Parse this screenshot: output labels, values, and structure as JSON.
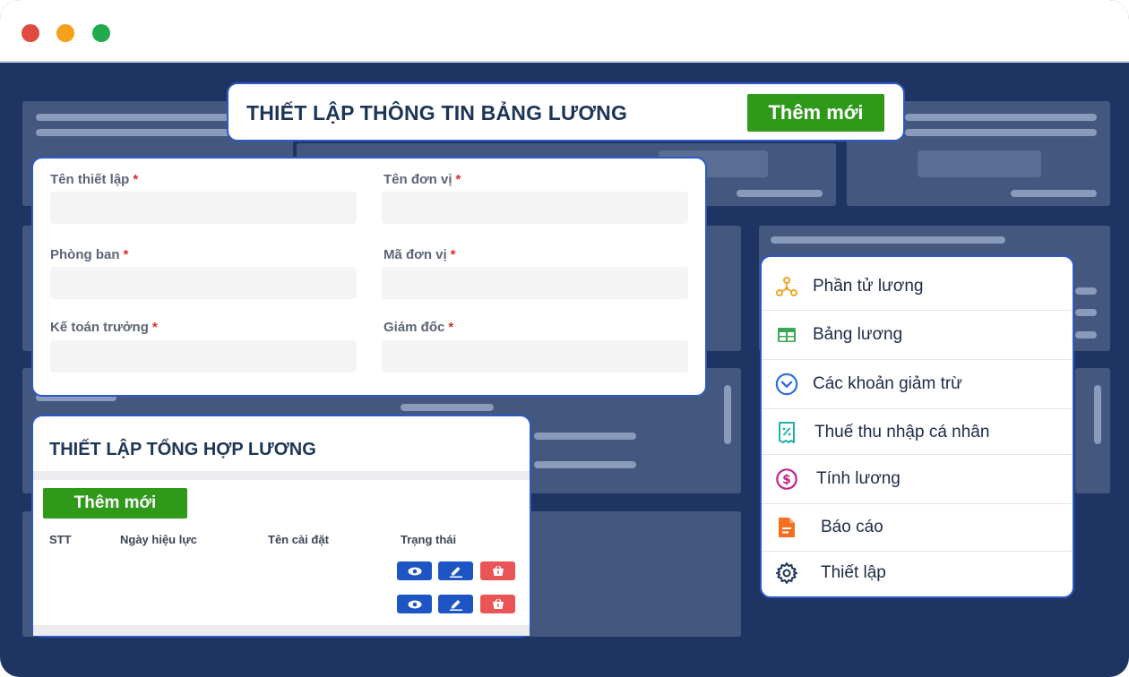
{
  "window": {
    "controls": [
      {
        "name": "close",
        "color": "#e04b40"
      },
      {
        "name": "minimize",
        "color": "#f5a11c"
      },
      {
        "name": "maximize",
        "color": "#23a94d"
      }
    ]
  },
  "header_card": {
    "title": "THIẾT LẬP THÔNG TIN BẢNG LƯƠNG",
    "add_button": "Thêm mới"
  },
  "form": {
    "fields": [
      {
        "label": "Tên thiết lập",
        "required": "*",
        "value": ""
      },
      {
        "label": "Tên đơn vị",
        "required": "*",
        "value": ""
      },
      {
        "label": "Phòng ban",
        "required": "*",
        "value": ""
      },
      {
        "label": "Mã đơn vị",
        "required": "*",
        "value": ""
      },
      {
        "label": "Kế toán trưởng",
        "required": "*",
        "value": ""
      },
      {
        "label": "Giám đốc",
        "required": "*",
        "value": ""
      }
    ]
  },
  "summary": {
    "title": "THIẾT LẬP TỔNG HỢP LƯƠNG",
    "add_button": "Thêm mới",
    "columns": [
      "STT",
      "Ngày hiệu lực",
      "Tên cài đặt",
      "Trạng thái"
    ],
    "row_actions": [
      "view-icon",
      "edit-icon",
      "delete-icon"
    ]
  },
  "menu": {
    "items": [
      {
        "label": "Phần tử lương",
        "icon": "hub-icon",
        "color": "#f0a522"
      },
      {
        "label": "Bảng lương",
        "icon": "table-icon",
        "color": "#3aa852"
      },
      {
        "label": "Các khoản giảm trừ",
        "icon": "chevron-circle-icon",
        "color": "#2d6fe0"
      },
      {
        "label": "Thuế thu nhập cá nhân",
        "icon": "receipt-icon",
        "color": "#1db3a6"
      },
      {
        "label": "Tính lương",
        "icon": "dollar-circle-icon",
        "color": "#c0248c"
      },
      {
        "label": "Báo cáo",
        "icon": "report-icon",
        "color": "#f37021"
      },
      {
        "label": "Thiết lập",
        "icon": "gear-icon",
        "color": "#1d3557"
      }
    ]
  },
  "colors": {
    "background": "#1e3564",
    "card_border": "#2d58c8",
    "primary_green": "#2f9a1a",
    "action_blue": "#1d55c4",
    "action_red": "#ea5455",
    "required_red": "#d92b2b"
  }
}
